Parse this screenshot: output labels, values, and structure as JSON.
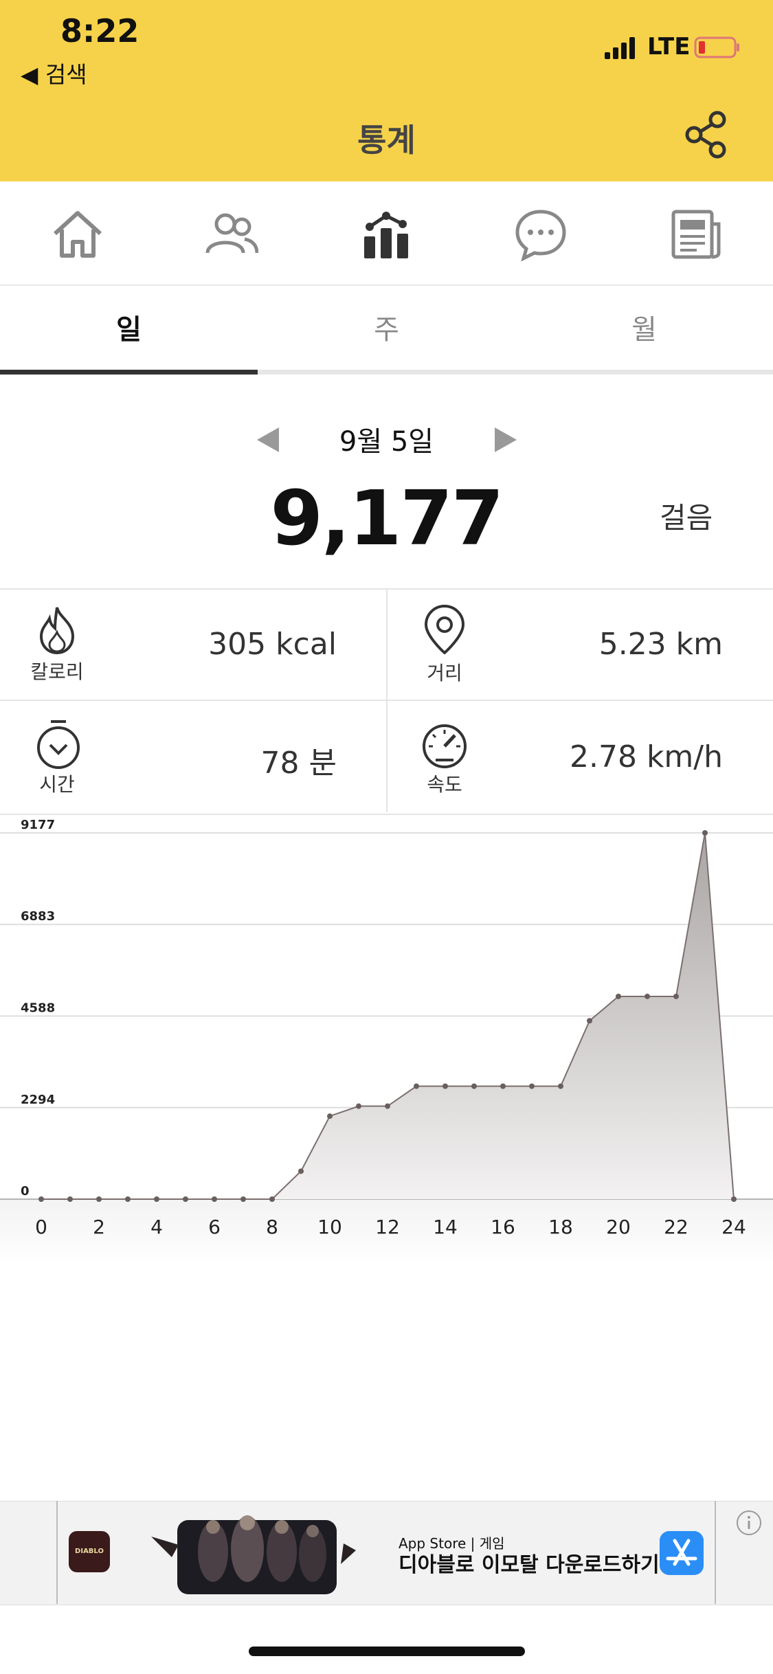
{
  "status_bar": {
    "time": "8:22",
    "back_label": "◀ 검색",
    "network": "LTE"
  },
  "header": {
    "title": "통계",
    "accent_color": "#F6D24A"
  },
  "nav": {
    "items": [
      "home-icon",
      "friends-icon",
      "statistics-icon",
      "chat-icon",
      "news-icon"
    ],
    "active": "statistics-icon"
  },
  "tabs": {
    "day": "일",
    "week": "주",
    "month": "월",
    "active": "day"
  },
  "summary": {
    "date": "9월 5일",
    "steps": "9,177",
    "steps_unit": "걸음"
  },
  "stats": {
    "calorie": {
      "label": "칼로리",
      "value": "305 kcal"
    },
    "distance": {
      "label": "거리",
      "value": "5.23 km"
    },
    "time": {
      "label": "시간",
      "value": "78 분"
    },
    "speed": {
      "label": "속도",
      "value": "2.78 km/h"
    }
  },
  "chart_data": {
    "type": "area",
    "x": [
      0,
      1,
      2,
      3,
      4,
      5,
      6,
      7,
      8,
      9,
      10,
      11,
      12,
      13,
      14,
      15,
      16,
      17,
      18,
      19,
      20,
      21,
      22,
      23,
      24
    ],
    "values": [
      0,
      0,
      0,
      0,
      0,
      0,
      0,
      0,
      0,
      700,
      2080,
      2330,
      2330,
      2830,
      2830,
      2830,
      2830,
      2830,
      2830,
      4470,
      5080,
      5080,
      5080,
      9177,
      0
    ],
    "x_ticks": [
      "0",
      "2",
      "4",
      "6",
      "8",
      "10",
      "12",
      "14",
      "16",
      "18",
      "20",
      "22",
      "24"
    ],
    "y_ticks": [
      "0",
      "2294",
      "4588",
      "6883",
      "9177"
    ],
    "ylim": [
      0,
      9177
    ],
    "xlim": [
      0,
      24
    ],
    "grid": true
  },
  "ad": {
    "store_label": "App Store | 게임",
    "title": "디아블로 이모탈 다운로드하기",
    "app_icon_text": "DIABLO"
  }
}
